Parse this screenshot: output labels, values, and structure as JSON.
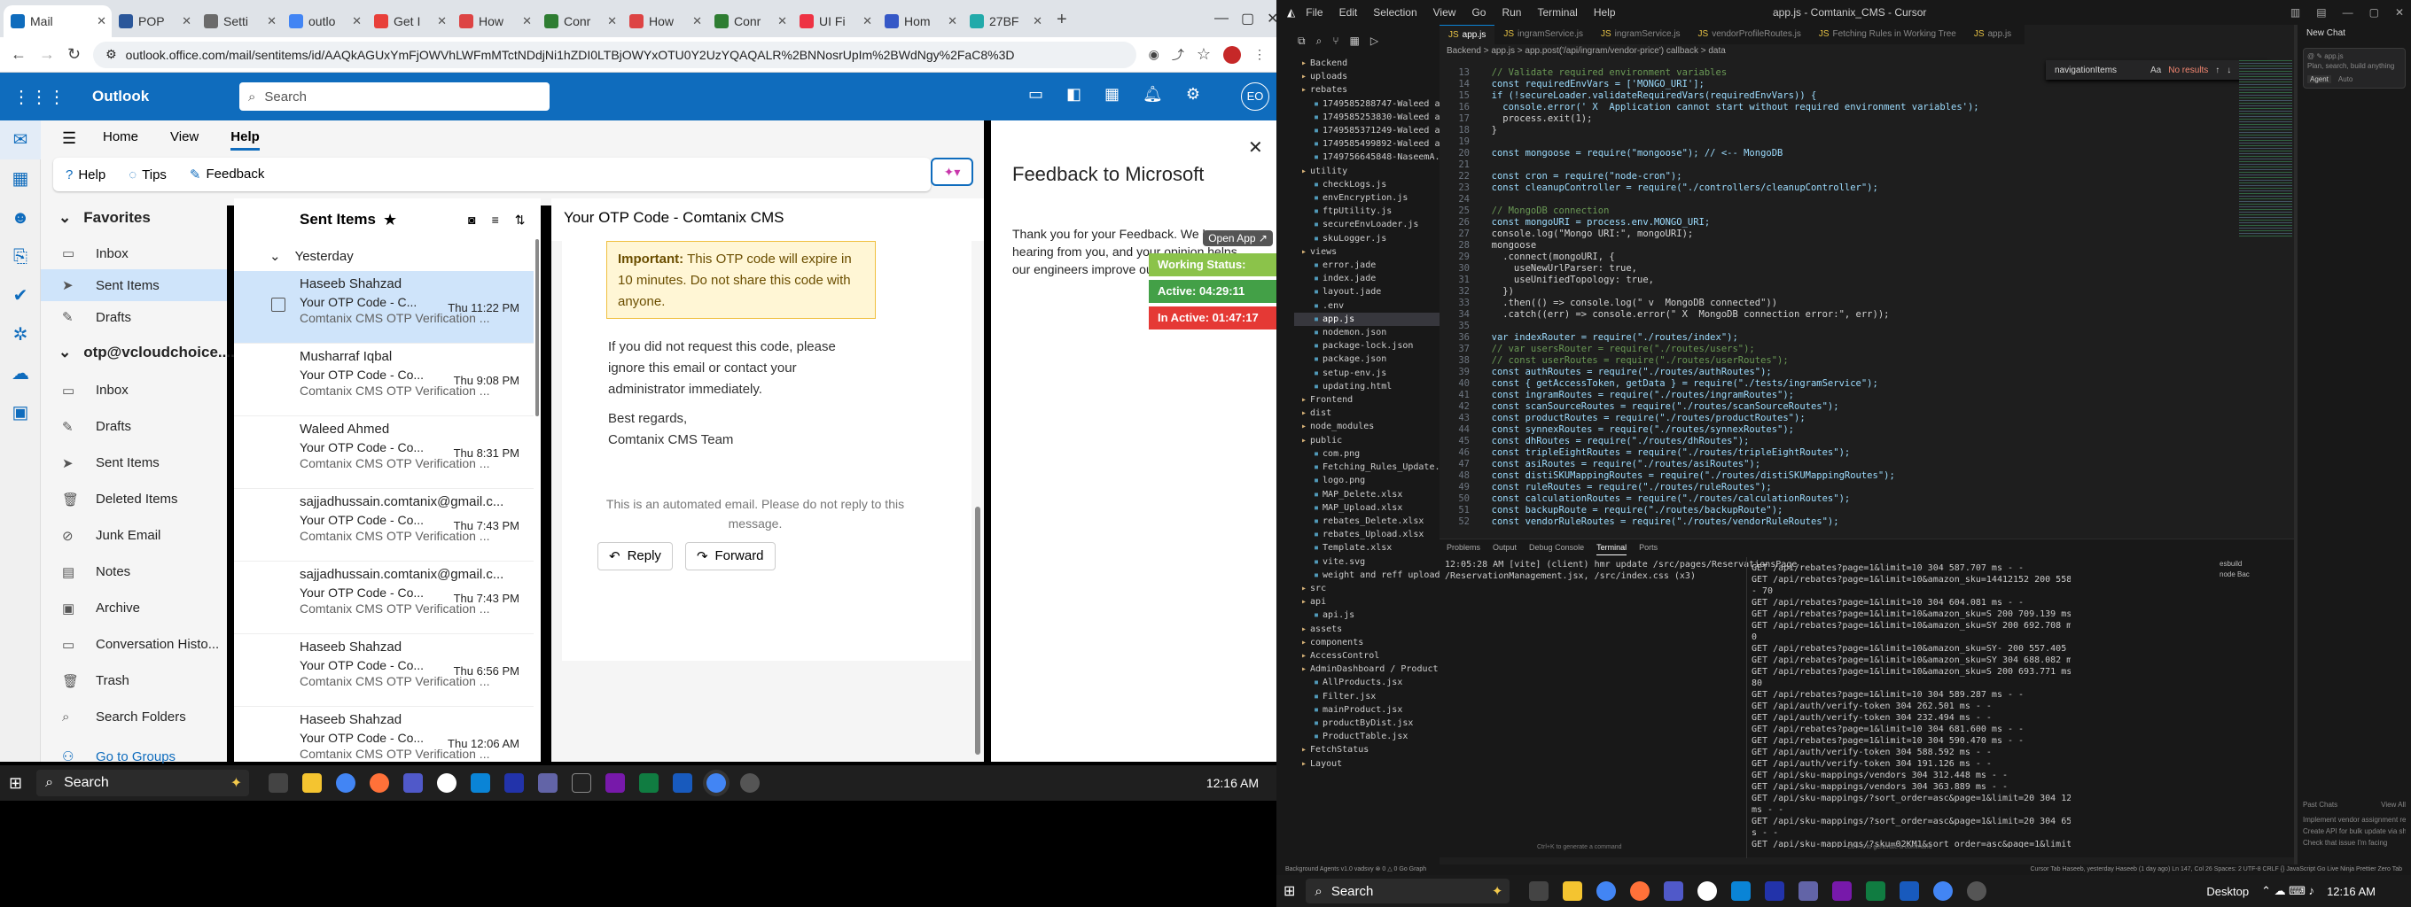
{
  "browser": {
    "tabs": [
      {
        "label": "Mail",
        "color": "#0f6cbd"
      },
      {
        "label": "POP",
        "color": "#2b579a"
      },
      {
        "label": "Setti",
        "color": "#6b6b6b"
      },
      {
        "label": "outlo",
        "color": "#4285f4"
      },
      {
        "label": "Get I",
        "color": "#e8403a"
      },
      {
        "label": "How",
        "color": "#d44"
      },
      {
        "label": "Conr",
        "color": "#2e7d32"
      },
      {
        "label": "How",
        "color": "#d44"
      },
      {
        "label": "Conr",
        "color": "#2e7d32"
      },
      {
        "label": "UI Fi",
        "color": "#e34"
      },
      {
        "label": "Hom",
        "color": "#3558c7"
      },
      {
        "label": "27BF",
        "color": "#2aa"
      }
    ],
    "url": "outlook.office.com/mail/sentitems/id/AAQkAGUxYmFjOWVhLWFmMTctNDdjNi1hZDI0LTBjOWYxOTU0Y2UzYQAQALR%2BNNosrUpIm%2BWdNgy%2FaC8%3D"
  },
  "outlook": {
    "brand": "Outlook",
    "search_placeholder": "Search",
    "avatar": "EO",
    "ribbon_tabs": [
      "Home",
      "View",
      "Help"
    ],
    "ribbon_buttons": [
      "Help",
      "Tips",
      "Feedback"
    ],
    "favorites_title": "Favorites",
    "favorites": [
      "Inbox",
      "Sent Items",
      "Drafts"
    ],
    "account": "otp@vcloudchoice....",
    "account_folders": [
      "Inbox",
      "Drafts",
      "Sent Items",
      "Deleted Items",
      "Junk Email",
      "Notes",
      "Archive",
      "Conversation Histo...",
      "Trash",
      "Search Folders"
    ],
    "go_to_groups": "Go to Groups",
    "list_title": "Sent Items",
    "group_label": "Yesterday",
    "messages": [
      {
        "from": "Haseeb Shahzad",
        "subject": "Your OTP Code - C...",
        "time": "Thu 11:22 PM",
        "preview": "Comtanix CMS OTP Verification ..."
      },
      {
        "from": "Musharraf Iqbal",
        "subject": "Your OTP Code - Co...",
        "time": "Thu 9:08 PM",
        "preview": "Comtanix CMS OTP Verification ..."
      },
      {
        "from": "Waleed Ahmed",
        "subject": "Your OTP Code - Co...",
        "time": "Thu 8:31 PM",
        "preview": "Comtanix CMS OTP Verification ..."
      },
      {
        "from": "sajjadhussain.comtanix@gmail.c...",
        "subject": "Your OTP Code - Co...",
        "time": "Thu 7:43 PM",
        "preview": "Comtanix CMS OTP Verification ..."
      },
      {
        "from": "sajjadhussain.comtanix@gmail.c...",
        "subject": "Your OTP Code - Co...",
        "time": "Thu 7:43 PM",
        "preview": "Comtanix CMS OTP Verification ..."
      },
      {
        "from": "Haseeb Shahzad",
        "subject": "Your OTP Code - Co...",
        "time": "Thu 6:56 PM",
        "preview": "Comtanix CMS OTP Verification ..."
      },
      {
        "from": "Haseeb Shahzad",
        "subject": "Your OTP Code - Co...",
        "time": "Thu 12:06 AM",
        "preview": "Comtanix CMS OTP Verification ..."
      }
    ],
    "reading": {
      "subject": "Your OTP Code - Comtanix CMS",
      "important_label": "Important:",
      "important_text": "This OTP code will expire in 10 minutes. Do not share this code with anyone.",
      "para": "If you did not request this code, please ignore this email or contact your administrator immediately.",
      "regards": "Best regards,",
      "team": "Comtanix CMS Team",
      "footer": "This is an automated email. Please do not reply to this message.",
      "reply": "Reply",
      "forward": "Forward"
    },
    "feedback": {
      "title": "Feedback to Microsoft",
      "text": "Thank you for your Feedback. We love hearing from you, and your opinion helps our engineers improve our products."
    }
  },
  "status_widget": {
    "open_app": "Open App ↗",
    "working": "Working Status: Active",
    "active": "Active: 04:29:11",
    "inactive": "In Active: 01:47:17"
  },
  "taskbar_left": {
    "search": "Search",
    "time": "12:16 AM"
  },
  "vscode": {
    "menu": [
      "File",
      "Edit",
      "Selection",
      "View",
      "Go",
      "Run",
      "Terminal",
      "Help"
    ],
    "title": "app.js - Comtanix_CMS - Cursor",
    "tabs": [
      "app.js",
      "ingramService.js",
      "ingramService.js",
      "vendorProfileRoutes.js",
      "Fetching Rules in Working Tree",
      "app.js"
    ],
    "breadcrumb": "Backend  >  app.js  >  app.post('/api/ingram/vendor-price') callback  >  data",
    "find_label": "navigationItems",
    "find_result": "No results",
    "code_lines": [
      "  // Validate required environment variables",
      "  const requiredEnvVars = ['MONGO_URI'];",
      "  if (!secureLoader.validateRequiredVars(requiredEnvVars)) {",
      "    console.error(' X  Application cannot start without required environment variables');",
      "    process.exit(1);",
      "  }",
      "",
      "  const mongoose = require(\"mongoose\"); // <-- MongoDB",
      "",
      "  const cron = require(\"node-cron\");",
      "  const cleanupController = require(\"./controllers/cleanupController\");",
      "",
      "  // MongoDB connection",
      "  const mongoURI = process.env.MONGO_URI;",
      "  console.log(\"Mongo URI:\", mongoURI);",
      "  mongoose",
      "    .connect(mongoURI, {",
      "      useNewUrlParser: true,",
      "      useUnifiedTopology: true,",
      "    })",
      "    .then(() => console.log(\" v  MongoDB connected\"))",
      "    .catch((err) => console.error(\" X  MongoDB connection error:\", err));",
      "",
      "  var indexRouter = require(\"./routes/index\");",
      "  // var usersRouter = require(\"./routes/users\");",
      "  // const userRoutes = require(\"./routes/userRoutes\");",
      "  const authRoutes = require(\"./routes/authRoutes\");",
      "  const { getAccessToken, getData } = require(\"./tests/ingramService\");",
      "  const ingramRoutes = require(\"./routes/ingramRoutes\");",
      "  const scanSourceRoutes = require(\"./routes/scanSourceRoutes\");",
      "  const productRoutes = require(\"./routes/productRoutes\");",
      "  const synnexRoutes = require(\"./routes/synnexRoutes\");",
      "  const dhRoutes = require(\"./routes/dhRoutes\");",
      "  const tripleEightRoutes = require(\"./routes/tripleEightRoutes\");",
      "  const asiRoutes = require(\"./routes/asiRoutes\");",
      "  const distiSKUMappingRoutes = require(\"./routes/distiSKUMappingRoutes\");",
      "  const ruleRoutes = require(\"./routes/ruleRoutes\");",
      "  const calculationRoutes = require(\"./routes/calculationRoutes\");",
      "  const backupRoute = require(\"./routes/backupRoute\");",
      "  const vendorRuleRoutes = require(\"./routes/vendorRuleRoutes\");"
    ],
    "line_start": "13",
    "explorer": [
      "Backend",
      "uploads",
      "rebates",
      "1749585288747-Waleed ay...",
      "1749585253830-Waleed ay...",
      "1749585371249-Waleed ay...",
      "1749585499892-Waleed ay...",
      "1749756645848-NaseemA...",
      "utility",
      "checkLogs.js",
      "envEncryption.js",
      "ftpUtility.js",
      "secureEnvLoader.js",
      "skuLogger.js",
      "views",
      "error.jade",
      "index.jade",
      "layout.jade",
      ".env",
      "app.js",
      "nodemon.json",
      "package-lock.json",
      "package.json",
      "setup-env.js",
      "updating.html",
      "Frontend",
      "dist",
      "node_modules",
      "public",
      "com.png",
      "Fetching_Rules_Update.xlsx",
      "logo.png",
      "MAP_Delete.xlsx",
      "MAP_Upload.xlsx",
      "rebates_Delete.xlsx",
      "rebates_Upload.xlsx",
      "Template.xlsx",
      "vite.svg",
      "weight and reff upload.xlsx",
      "src",
      "api",
      "api.js",
      "assets",
      "components",
      "AccessControl",
      "AdminDashboard / Product",
      "AllProducts.jsx",
      "Filter.jsx",
      "mainProduct.jsx",
      "productByDist.jsx",
      "ProductTable.jsx",
      "FetchStatus",
      "Layout"
    ],
    "panel_tabs": [
      "Problems",
      "Output",
      "Debug Console",
      "Terminal",
      "Ports"
    ],
    "term_left": [
      "12:05:28 AM [vite] (client) hmr update /src/pages/ReservationsPage",
      "/ReservationManagement.jsx, /src/index.css (x3)"
    ],
    "term_right": [
      "GET /api/rebates?page=1&limit=10 304 587.707 ms - -",
      "GET /api/rebates?page=1&limit=10&amazon_sku=14412152 200 558.702 ms",
      "- 70",
      "GET /api/rebates?page=1&limit=10 304 604.081 ms - -",
      "GET /api/rebates?page=1&limit=10&amazon_sku=S 200 709.139 ms - 2440",
      "GET /api/rebates?page=1&limit=10&amazon_sku=SY 200 692.708 ms - 188",
      "0",
      "GET /api/rebates?page=1&limit=10&amazon_sku=SY- 200 557.405 ms - 70",
      "GET /api/rebates?page=1&limit=10&amazon_sku=SY 304 688.082 ms - -",
      "GET /api/rebates?page=1&limit=10&amazon_sku=S 200 693.771 ms - 18",
      "80",
      "GET /api/rebates?page=1&limit=10 304 589.287 ms - -",
      "GET /api/auth/verify-token 304 262.501 ms - -",
      "GET /api/auth/verify-token 304 232.494 ms - -",
      "GET /api/rebates?page=1&limit=10 304 681.600 ms - -",
      "GET /api/rebates?page=1&limit=10 304 590.470 ms - -",
      "GET /api/auth/verify-token 304 588.592 ms - -",
      "GET /api/auth/verify-token 304 191.126 ms - -",
      "GET /api/sku-mappings/vendors 304 312.448 ms - -",
      "GET /api/sku-mappings/vendors 304 363.889 ms - -",
      "GET /api/sku-mappings/?sort_order=asc&page=1&limit=20 304 1202.532",
      "ms - -",
      "GET /api/sku-mappings/?sort_order=asc&page=1&limit=20 304 653.132 m",
      "s - -",
      "GET /api/sku-mappings/?sku=02KM1&sort_order=asc&page=1&limit=20 20",
      "0 927.961 ms - 2464"
    ],
    "term_sessions": [
      "esbuild",
      "node  Bac"
    ],
    "chat_title": "New Chat",
    "chat_placeholder": "Plan, search, build anything",
    "chat_agent": "Agent",
    "chat_auto": "Auto",
    "past_chats_title": "Past Chats",
    "past_chats": [
      "Implement vendor assignment restrictions",
      "Create API for bulk update via sheet",
      "Check that issue I'm facing"
    ],
    "view_all": "View All",
    "status_left": "Background Agents   v1.0 vadsvy   ⊗ 0 △ 0   Go Graph",
    "status_right": "Cursor Tab   Haseeb, yesterday   Haseeb (1 day ago)   Ln 147, Col 26   Spaces: 2   UTF-8   CRLF   {} JavaScript   Go Live   Ninja   Prettier   Zero Tab",
    "cmdk_hint": "Ctrl+K to generate a command"
  },
  "taskbar_right": {
    "search": "Search",
    "desktop": "Desktop",
    "time": "12:16 AM"
  }
}
